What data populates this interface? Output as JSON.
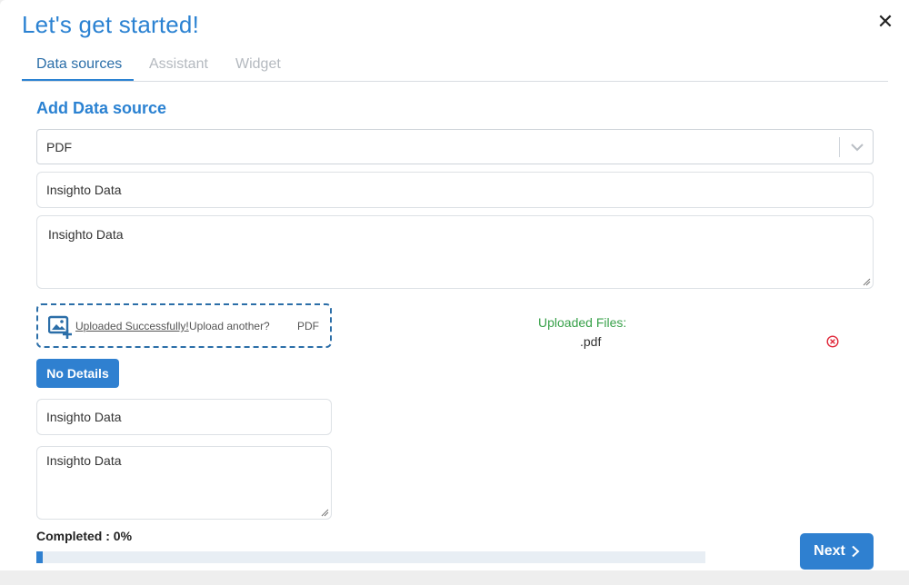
{
  "modal": {
    "title": "Let's get started!",
    "close_icon": "close-icon"
  },
  "tabs": [
    {
      "label": "Data sources",
      "active": true
    },
    {
      "label": "Assistant",
      "active": false
    },
    {
      "label": "Widget",
      "active": false
    }
  ],
  "form": {
    "section_title": "Add Data source",
    "source_type": {
      "selected": "PDF",
      "icon": "chevron-down-icon"
    },
    "name_value": "Insighto Data",
    "description_value": "Insighto Data"
  },
  "upload": {
    "icon": "image-upload-icon",
    "status_link": "Uploaded Successfully!",
    "upload_another": "Upload another?",
    "file_type": "PDF",
    "uploaded_files_label": "Uploaded Files:",
    "uploaded_file_name": ".pdf",
    "remove_icon": "remove-circle-icon"
  },
  "details": {
    "no_details_label": "No Details",
    "name_value": "Insighto Data",
    "description_value": "Insighto Data"
  },
  "progress": {
    "label": "Completed : 0%",
    "value_percent": 1
  },
  "footer": {
    "next_label": "Next",
    "next_icon": "chevron-right-icon"
  },
  "colors": {
    "accent": "#2b82d2",
    "button": "#2f80d0",
    "success": "#38a14a",
    "danger": "#e0283a"
  }
}
